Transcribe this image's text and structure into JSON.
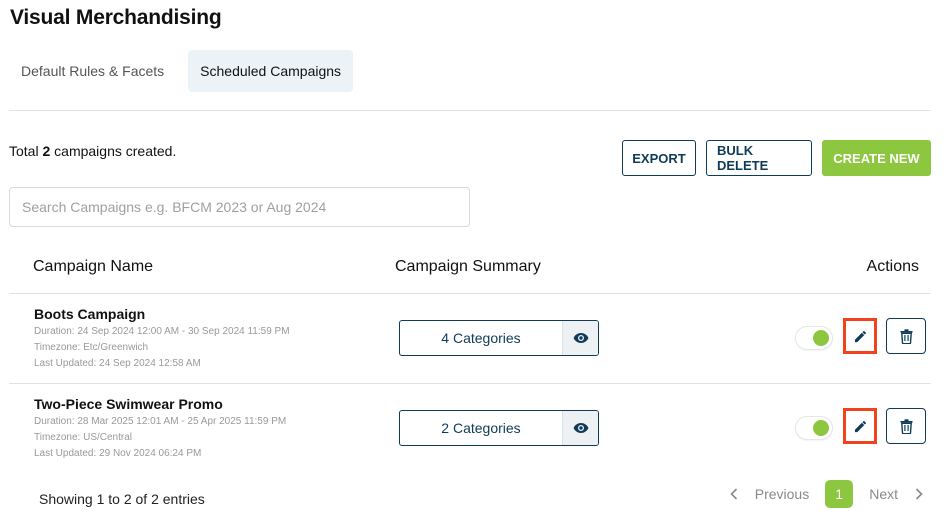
{
  "page": {
    "title": "Visual Merchandising"
  },
  "tabs": [
    {
      "label": "Default Rules & Facets",
      "active": false
    },
    {
      "label": "Scheduled Campaigns",
      "active": true
    }
  ],
  "summary": {
    "prefix": "Total ",
    "count": "2",
    "suffix": " campaigns created."
  },
  "toolbar": {
    "export_label": "EXPORT",
    "bulk_delete_label": "BULK DELETE",
    "create_new_label": "CREATE NEW"
  },
  "search": {
    "placeholder": "Search Campaigns e.g. BFCM 2023 or Aug 2024",
    "value": ""
  },
  "table": {
    "headers": {
      "name": "Campaign Name",
      "summary": "Campaign Summary",
      "actions": "Actions"
    },
    "rows": [
      {
        "name": "Boots Campaign",
        "duration": "Duration:  24 Sep 2024 12:00 AM - 30 Sep 2024 11:59 PM",
        "timezone": "Timezone:  Etc/Greenwich",
        "last_updated": "Last Updated:  24 Sep 2024 12:58 AM",
        "categories": "4 Categories",
        "enabled": true
      },
      {
        "name": "Two-Piece Swimwear Promo",
        "duration": "Duration:  28 Mar 2025 12:01 AM - 25 Apr 2025 11:59 PM",
        "timezone": "Timezone:  US/Central",
        "last_updated": "Last Updated:  29 Nov 2024 06:24 PM",
        "categories": "2 Categories",
        "enabled": true
      }
    ]
  },
  "footer": {
    "info": "Showing 1 to 2 of 2 entries"
  },
  "pagination": {
    "previous": "Previous",
    "next": "Next",
    "current_page": "1"
  },
  "colors": {
    "primary": "#0e3b57",
    "accent": "#8dc63f",
    "highlight": "#f0421c"
  }
}
